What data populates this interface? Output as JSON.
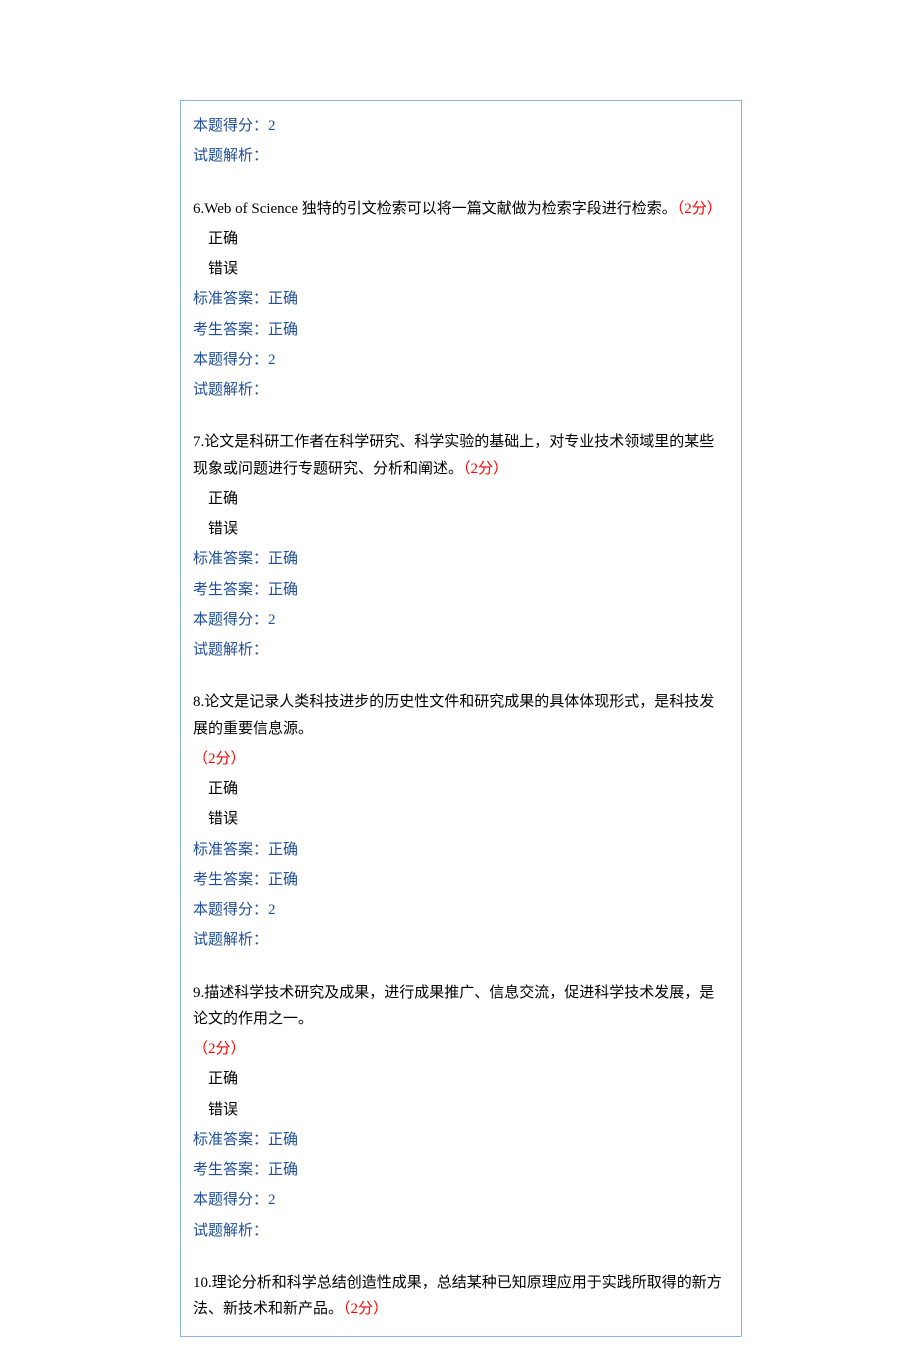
{
  "top": {
    "score_label": "本题得分：",
    "score_value": "2",
    "analysis_label": "试题解析："
  },
  "q6": {
    "num": "6.",
    "text": "Web of Science 独特的引文检索可以将一篇文献做为检索字段进行检索。",
    "points": "（2分）",
    "opt_correct": "正确",
    "opt_wrong": "错误",
    "std_label": "标准答案：",
    "std_value": "正确",
    "cand_label": "考生答案：",
    "cand_value": "正确",
    "score_label": "本题得分：",
    "score_value": "2",
    "analysis_label": "试题解析："
  },
  "q7": {
    "num": "7.",
    "text": "论文是科研工作者在科学研究、科学实验的基础上，对专业技术领域里的某些现象或问题进行专题研究、分析和阐述。",
    "points": "（2分）",
    "opt_correct": "正确",
    "opt_wrong": "错误",
    "std_label": "标准答案：",
    "std_value": "正确",
    "cand_label": "考生答案：",
    "cand_value": "正确",
    "score_label": "本题得分：",
    "score_value": "2",
    "analysis_label": "试题解析："
  },
  "q8": {
    "num": "8.",
    "text": "论文是记录人类科技进步的历史性文件和研究成果的具体体现形式，是科技发展的重要信息源。",
    "points": "（2分）",
    "opt_correct": "正确",
    "opt_wrong": "错误",
    "std_label": "标准答案：",
    "std_value": "正确",
    "cand_label": "考生答案：",
    "cand_value": "正确",
    "score_label": "本题得分：",
    "score_value": "2",
    "analysis_label": "试题解析："
  },
  "q9": {
    "num": "9.",
    "text": "描述科学技术研究及成果，进行成果推广、信息交流，促进科学技术发展，是论文的作用之一。",
    "points": "（2分）",
    "opt_correct": "正确",
    "opt_wrong": "错误",
    "std_label": "标准答案：",
    "std_value": "正确",
    "cand_label": "考生答案：",
    "cand_value": "正确",
    "score_label": "本题得分：",
    "score_value": "2",
    "analysis_label": "试题解析："
  },
  "q10": {
    "num": "10.",
    "text": "理论分析和科学总结创造性成果，总结某种已知原理应用于实践所取得的新方法、新技术和新产品。",
    "points": "（2分）"
  }
}
